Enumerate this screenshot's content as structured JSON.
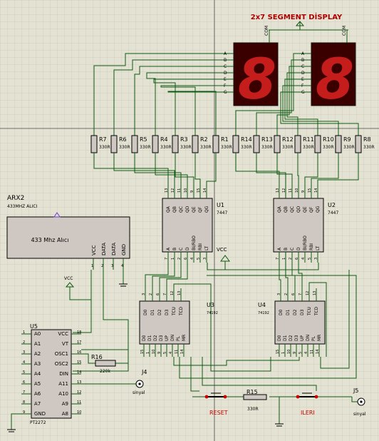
{
  "title": "2x7 SEGMENT DİSPLAY",
  "display": {
    "com": "COM",
    "digit": "8",
    "segments": [
      "A",
      "B",
      "C",
      "D",
      "E",
      "F",
      "G"
    ]
  },
  "resistors": [
    {
      "name": "R7",
      "value": "330R"
    },
    {
      "name": "R6",
      "value": "330R"
    },
    {
      "name": "R5",
      "value": "330R"
    },
    {
      "name": "R4",
      "value": "330R"
    },
    {
      "name": "R3",
      "value": "330R"
    },
    {
      "name": "R2",
      "value": "330R"
    },
    {
      "name": "R1",
      "value": "330R"
    },
    {
      "name": "R14",
      "value": "330R"
    },
    {
      "name": "R13",
      "value": "330R"
    },
    {
      "name": "R12",
      "value": "330R"
    },
    {
      "name": "R11",
      "value": "330R"
    },
    {
      "name": "R10",
      "value": "330R"
    },
    {
      "name": "R9",
      "value": "330R"
    },
    {
      "name": "R8",
      "value": "330R"
    }
  ],
  "u1": {
    "name": "U1",
    "part": "7447"
  },
  "u2": {
    "name": "U2",
    "part": "7447"
  },
  "decoder_pins_top": [
    "QA",
    "QB",
    "QC",
    "QD",
    "QE",
    "QF",
    "QG"
  ],
  "decoder_pin_nums_top": [
    "13",
    "12",
    "11",
    "10",
    "9",
    "15",
    "14"
  ],
  "decoder_pins_bottom": [
    "A",
    "B",
    "C",
    "D",
    "BI/RBO",
    "RBI",
    "LT"
  ],
  "decoder_pin_nums_bottom": [
    "7",
    "1",
    "2",
    "6",
    "4",
    "5",
    "3"
  ],
  "u3": {
    "name": "U3",
    "part": "74192"
  },
  "u4": {
    "name": "U4",
    "part": "74192"
  },
  "counter_pins_top": [
    "D0",
    "D1",
    "D2",
    "D3",
    "TCU",
    "TCD"
  ],
  "counter_pin_nums_top": [
    "3",
    "2",
    "6",
    "7",
    "12",
    "13"
  ],
  "counter_pins_bottom": [
    "D0",
    "D1",
    "D2",
    "D3",
    "UP",
    "DN",
    "PL",
    "MR"
  ],
  "counter_pin_nums_bottom": [
    "15",
    "1",
    "10",
    "9",
    "5",
    "4",
    "11",
    "14"
  ],
  "vcc": "VCC",
  "arx2": {
    "name": "ARX2",
    "subtitle": "433MHZ ALICI",
    "body": "433 Mhz Alıcı",
    "pins": [
      "VCC",
      "DATA",
      "DATA",
      "GND"
    ],
    "pin_nums": [
      "1",
      "2",
      "3",
      "4"
    ]
  },
  "u5": {
    "name": "U5",
    "part": "PT2272",
    "left_pins": [
      "A0",
      "A1",
      "A2",
      "A3",
      "A4",
      "A5",
      "A6",
      "A7",
      "GND"
    ],
    "left_nums": [
      "1",
      "2",
      "3",
      "4",
      "5",
      "6",
      "7",
      "8",
      "9"
    ],
    "right_pins": [
      "VCC",
      "VT",
      "OSC1",
      "OSC2",
      "DIN",
      "A11",
      "A10",
      "A9",
      "A8"
    ],
    "right_nums": [
      "18",
      "17",
      "16",
      "15",
      "14",
      "13",
      "12",
      "11",
      "10"
    ]
  },
  "r16": {
    "name": "R16",
    "value": "220k"
  },
  "r15": {
    "name": "R15",
    "value": "330R"
  },
  "j4": {
    "name": "J4",
    "label": "sinyal"
  },
  "j5": {
    "name": "J5",
    "label": "sinyal"
  },
  "reset_label": "RESET",
  "ileri_label": "ILERI",
  "colors": {
    "background": "#e4e2d2",
    "grid": "#cfcdbd",
    "wire": "#0c5a12",
    "body": "#cfc7c2",
    "outline": "#000000",
    "segment_bg": "#3a0000",
    "segment_on": "#c51c1c",
    "title": "#b00000"
  }
}
